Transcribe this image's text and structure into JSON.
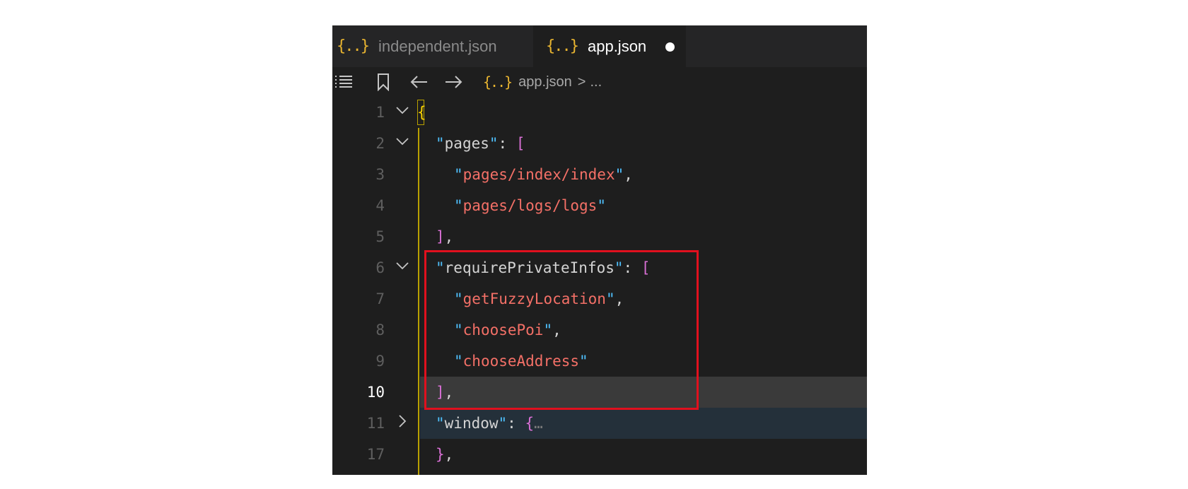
{
  "tabs": [
    {
      "icon": "{..}",
      "label": "independent.json"
    },
    {
      "icon": "{..}",
      "label": "app.json",
      "dirty": true
    }
  ],
  "breadcrumb": {
    "icon": "{..}",
    "file": "app.json",
    "separator": ">",
    "rest": "..."
  },
  "icons": [
    "list-icon",
    "bookmark-icon",
    "back-arrow-icon",
    "forward-arrow-icon",
    "json-file-icon",
    "chevron-down-icon",
    "chevron-right-icon"
  ],
  "colors": {
    "highlight_box": "#e0101e",
    "string": "#f47067",
    "quote": "#4fc1ff",
    "bracket_yellow": "#ffd700",
    "bracket_magenta": "#da70d6"
  },
  "code": {
    "line_numbers": [
      "1",
      "2",
      "3",
      "4",
      "5",
      "6",
      "7",
      "8",
      "9",
      "10",
      "11",
      "17"
    ],
    "l1_brace": "{",
    "l2_key": "pages",
    "l2_bracket": "[",
    "l3_value": "pages/index/index",
    "l4_value": "pages/logs/logs",
    "l5_bracket": "]",
    "l6_key": "requirePrivateInfos",
    "l6_bracket": "[",
    "l7_value": "getFuzzyLocation",
    "l8_value": "choosePoi",
    "l9_value": "chooseAddress",
    "l10_bracket": "]",
    "l11_key": "window",
    "l11_brace": "{",
    "l11_folded": "…",
    "l17_brace": "}"
  }
}
